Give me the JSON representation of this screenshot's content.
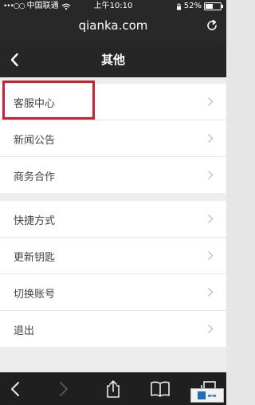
{
  "status_bar": {
    "signal": "•••○○",
    "carrier": "中国联通",
    "time": "上午10:10",
    "battery_percent": "52%",
    "battery_level": 0.52
  },
  "browser": {
    "url": "qianka.com"
  },
  "header": {
    "title": "其他"
  },
  "menu_group_1": [
    {
      "label": "客服中心"
    },
    {
      "label": "新闻公告"
    },
    {
      "label": "商务合作"
    }
  ],
  "menu_group_2": [
    {
      "label": "快捷方式"
    },
    {
      "label": "更新钥匙"
    },
    {
      "label": "切换账号"
    },
    {
      "label": "退出"
    }
  ],
  "colors": {
    "highlight": "#c8212f",
    "topbar": "#282828",
    "toolbar": "#1f1f1f"
  },
  "icons": {
    "back": "chevron-left-icon",
    "reload": "reload-icon",
    "item_arrow": "chevron-right-icon",
    "toolbar": [
      "back-arrow-icon",
      "forward-arrow-icon",
      "share-icon",
      "bookmarks-icon",
      "tabs-icon"
    ]
  }
}
